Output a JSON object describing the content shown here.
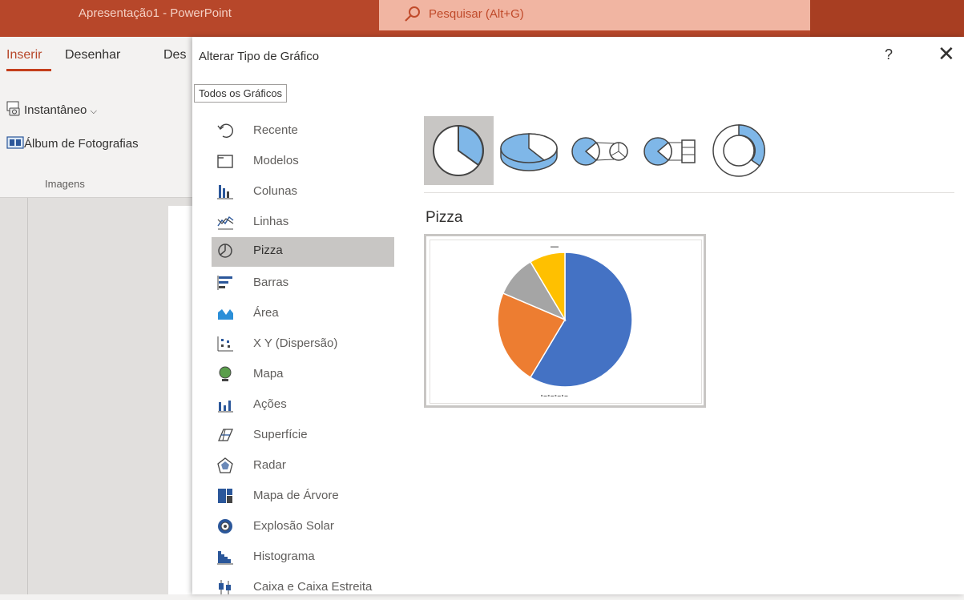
{
  "window": {
    "app_title": "Apresentação1  -  PowerPoint",
    "search_placeholder": "Pesquisar (Alt+G)",
    "accent": "#b7472a"
  },
  "ribbon": {
    "tabs": [
      "Inserir",
      "Desenhar",
      "Des"
    ],
    "active_tab": "Inserir",
    "buttons": {
      "screenshot": "Instantâneo",
      "photo_album": "Álbum de Fotografias"
    },
    "group_label": "Imagens"
  },
  "dialog": {
    "title": "Alterar Tipo de Gráfico",
    "help": "?",
    "close": "✕",
    "tab_all": "Todos os Gráficos",
    "categories": [
      {
        "label": "Recente",
        "icon": "recent-icon"
      },
      {
        "label": "Modelos",
        "icon": "templates-icon"
      },
      {
        "label": "Colunas",
        "icon": "column-chart-icon"
      },
      {
        "label": "Linhas",
        "icon": "line-chart-icon"
      },
      {
        "label": "Pizza",
        "icon": "pie-chart-icon"
      },
      {
        "label": "Barras",
        "icon": "bar-chart-icon"
      },
      {
        "label": "Área",
        "icon": "area-chart-icon"
      },
      {
        "label": "X Y (Dispersão)",
        "icon": "scatter-chart-icon"
      },
      {
        "label": "Mapa",
        "icon": "map-chart-icon"
      },
      {
        "label": "Ações",
        "icon": "stock-chart-icon"
      },
      {
        "label": "Superfície",
        "icon": "surface-chart-icon"
      },
      {
        "label": "Radar",
        "icon": "radar-chart-icon"
      },
      {
        "label": "Mapa de Árvore",
        "icon": "treemap-chart-icon"
      },
      {
        "label": "Explosão Solar",
        "icon": "sunburst-chart-icon"
      },
      {
        "label": "Histograma",
        "icon": "histogram-chart-icon"
      },
      {
        "label": "Caixa e Caixa Estreita",
        "icon": "box-whisker-chart-icon"
      }
    ],
    "selected_category": "Pizza",
    "subtypes": [
      "pie-icon",
      "pie-3d-icon",
      "pie-of-pie-icon",
      "bar-of-pie-icon",
      "doughnut-icon"
    ],
    "selected_subtype": "Pizza",
    "subtype_name": "Pizza",
    "preview": {
      "colors": [
        "#4472c4",
        "#ed7d31",
        "#a5a5a5",
        "#ffc000"
      ]
    }
  },
  "chart_data": {
    "type": "pie",
    "values": [
      8.2,
      3.2,
      1.4,
      1.2
    ],
    "colors": [
      "#4472c4",
      "#ed7d31",
      "#a5a5a5",
      "#ffc000"
    ]
  }
}
